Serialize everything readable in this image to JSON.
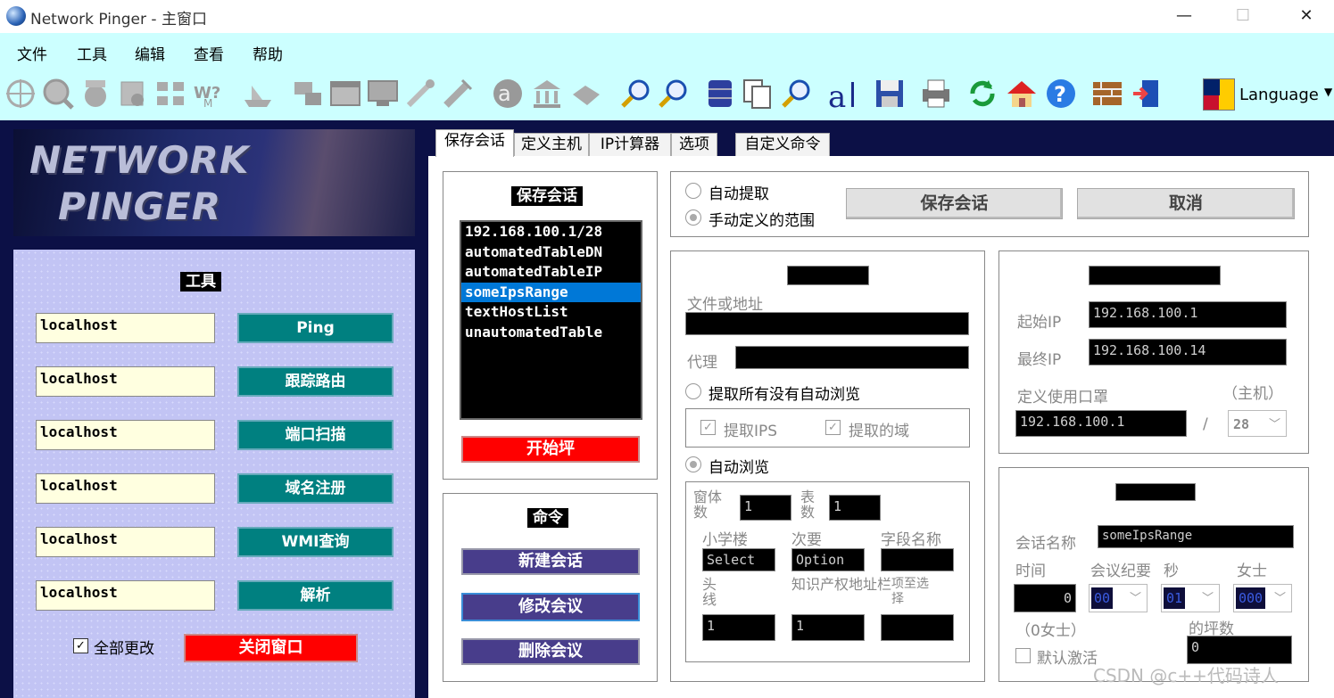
{
  "window": {
    "title": "Network Pinger - 主窗口",
    "minimize": "—",
    "maximize": "☐",
    "close": "✕"
  },
  "menu": [
    "文件",
    "工具",
    "编辑",
    "查看",
    "帮助"
  ],
  "toolbar": {
    "icons": [
      "crosshair-icon",
      "magnifier-globe-icon",
      "whois-icon",
      "scan-icon",
      "network-grid-icon",
      "wmi-icon",
      "ship-icon",
      "computer-network-icon",
      "window-icon",
      "monitor-icon",
      "cable-icon",
      "plug-icon",
      "at-sign-icon",
      "bank-icon",
      "route-icon",
      "find-icon",
      "find-next-icon",
      "database-icon",
      "copy-icon",
      "replace-icon",
      "font-icon",
      "save-icon",
      "print-icon",
      "refresh-icon",
      "home-icon",
      "help-icon",
      "firewall-icon",
      "exit-icon"
    ],
    "language_label": "Language"
  },
  "banner": {
    "line1": "NETWORK",
    "line2": "PINGER"
  },
  "tools": {
    "header": "工具",
    "rows": [
      {
        "host": "localhost",
        "button": "Ping"
      },
      {
        "host": "localhost",
        "button": "跟踪路由"
      },
      {
        "host": "localhost",
        "button": "端口扫描"
      },
      {
        "host": "localhost",
        "button": "域名注册"
      },
      {
        "host": "localhost",
        "button": "WMI查询"
      },
      {
        "host": "localhost",
        "button": "解析"
      }
    ],
    "all_change_label": "全部更改",
    "all_change_checked": true,
    "close_window": "关闭窗口"
  },
  "tabs": [
    "保存会话",
    "定义主机",
    "IP计算器",
    "选项",
    "自定义命令"
  ],
  "saved_sessions": {
    "header": "保存会话",
    "items": [
      "192.168.100.1/28",
      "automatedTableDN",
      "automatedTableIP",
      "someIpsRange",
      "textHostList",
      "unautomatedTable"
    ],
    "selected_index": 3,
    "start_button": "开始坪"
  },
  "commands": {
    "header": "命令",
    "new": "新建会话",
    "modify": "修改会议",
    "delete": "删除会议"
  },
  "mode": {
    "auto_extract": "自动提取",
    "manual_range": "手动定义的范围",
    "save_session": "保存会话",
    "cancel": "取消"
  },
  "extract": {
    "file_or_address": "文件或地址",
    "proxy": "代理",
    "extract_no_autobrowse": "提取所有没有自动浏览",
    "extract_ips": "提取IPS",
    "extract_domains": "提取的域",
    "auto_browse": "自动浏览",
    "frame_count_label": "窗体数",
    "frame_count": "1",
    "table_count_label": "表数",
    "table_count": "1",
    "tag_label": "小学楼",
    "tag_value": "Select",
    "secondary_label": "次要",
    "secondary_value": "Option",
    "field_name_label": "字段名称",
    "header_line_label": "头线",
    "header_line_value": "1",
    "ip_column_label": "知识产权地址栏",
    "ip_column_value": "1",
    "select_label": "项至选择"
  },
  "range": {
    "start_ip_label": "起始IP",
    "start_ip": "192.168.100.1",
    "end_ip_label": "最终IP",
    "end_ip": "192.168.100.14",
    "mask_label": "定义使用口罩",
    "hosts_label": "（主机）",
    "mask_ip": "192.168.100.1",
    "slash": "/",
    "prefix": "28"
  },
  "session": {
    "name_label": "会话名称",
    "name_value": "someIpsRange",
    "time_label": "时间",
    "minutes_label": "会议纪要",
    "seconds_label": "秒",
    "ms_label": "女士",
    "time_value": "0",
    "minutes_value": "00",
    "seconds_value": "01",
    "ms_value": "000",
    "zero_label": "（0女士）",
    "count_label": "的坪数",
    "count_value": "0",
    "default_active": "默认激活"
  },
  "watermark": "CSDN @c++代码诗人"
}
